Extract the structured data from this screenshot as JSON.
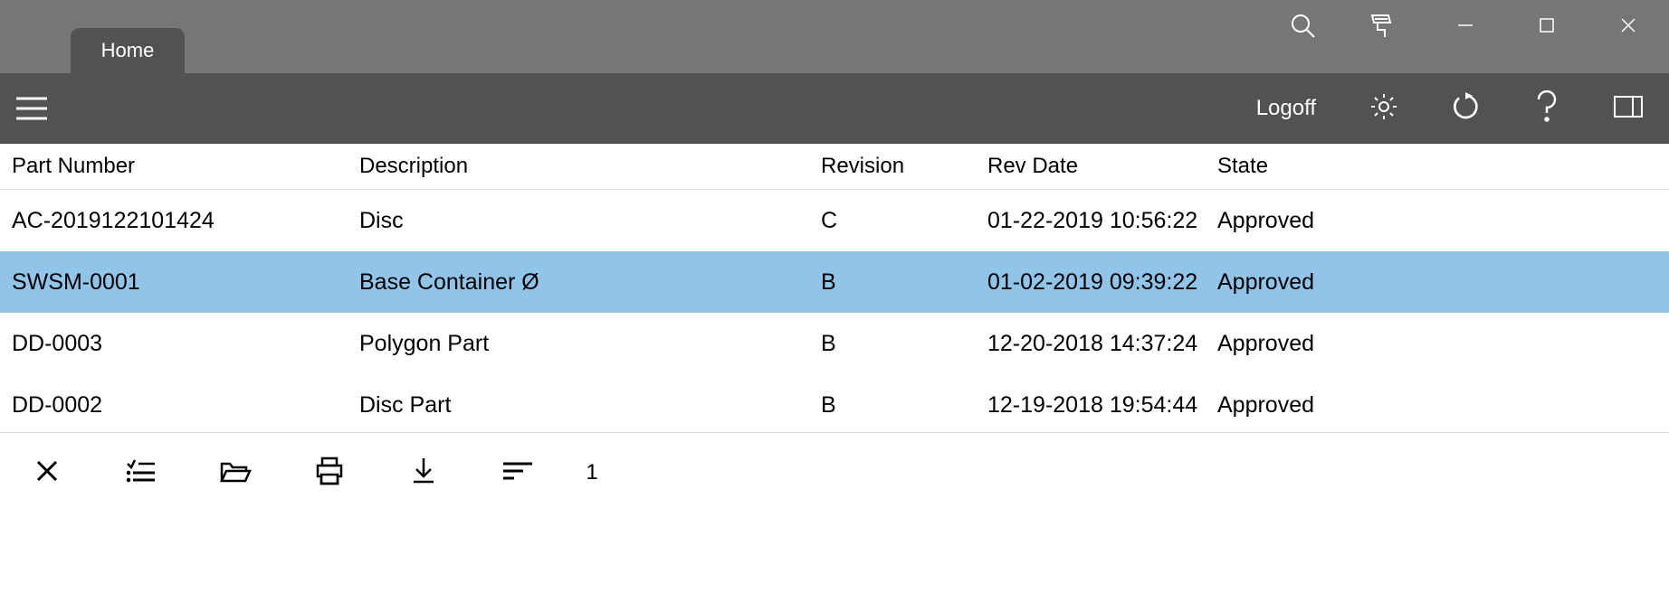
{
  "titlebar": {
    "tab_label": "Home"
  },
  "toolbar": {
    "logoff_label": "Logoff"
  },
  "columns": {
    "part_number": "Part Number",
    "description": "Description",
    "revision": "Revision",
    "rev_date": "Rev Date",
    "state": "State"
  },
  "rows": [
    {
      "selected": false,
      "part_number": "AC-2019122101424",
      "description": "Disc",
      "revision": "C",
      "rev_date": "01-22-2019 10:56:22",
      "state": "Approved"
    },
    {
      "selected": true,
      "part_number": "SWSM-0001",
      "description": "Base Container Ø",
      "revision": "B",
      "rev_date": "01-02-2019 09:39:22",
      "state": "Approved"
    },
    {
      "selected": false,
      "part_number": "DD-0003",
      "description": "Polygon Part",
      "revision": "B",
      "rev_date": "12-20-2018 14:37:24",
      "state": "Approved"
    },
    {
      "selected": false,
      "part_number": "DD-0002",
      "description": "Disc Part",
      "revision": "B",
      "rev_date": "12-19-2018 19:54:44",
      "state": "Approved"
    }
  ],
  "bottombar": {
    "page": "1"
  }
}
